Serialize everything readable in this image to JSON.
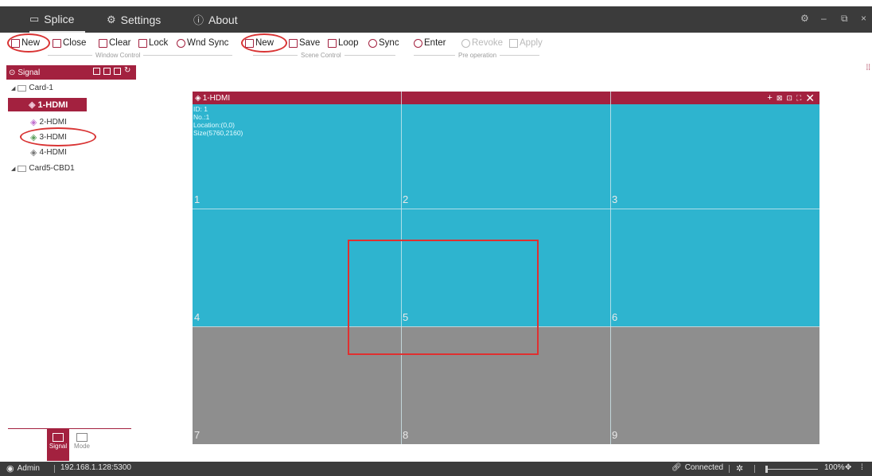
{
  "titlebar": {
    "tabs": [
      {
        "label": "Splice",
        "icon": "window-icon"
      },
      {
        "label": "Settings",
        "icon": "gear-icon"
      },
      {
        "label": "About",
        "icon": "info-icon"
      }
    ],
    "controls": {
      "settings": "⚙",
      "minimize": "–",
      "restore": "⧉",
      "close": "×"
    }
  },
  "toolbar": {
    "window_control": {
      "label": "Window Control",
      "buttons": [
        "New",
        "Close",
        "Clear",
        "Lock",
        "Wnd Sync"
      ]
    },
    "scene_control": {
      "label": "Scene Control",
      "buttons": [
        "New",
        "Save",
        "Loop",
        "Sync"
      ]
    },
    "pre_operation": {
      "label": "Pre operation",
      "buttons": [
        "Enter",
        "Revoke",
        "Apply"
      ]
    }
  },
  "left_panel": {
    "header": "Signal",
    "tree": {
      "card1": "Card-1",
      "signals": [
        "1-HDMI",
        "2-HDMI",
        "3-HDMI",
        "4-HDMI"
      ],
      "card2": "Card5-CBD1"
    },
    "bottom_tabs": [
      "Signal",
      "Mode"
    ]
  },
  "signal_window": {
    "title": "1-HDMI",
    "info": [
      "ID: 1",
      "No.:1",
      "Location:(0,0)",
      "Size(5760,2160)"
    ]
  },
  "grid_cells": [
    "1",
    "2",
    "3",
    "4",
    "5",
    "6",
    "7",
    "8",
    "9"
  ],
  "statusbar": {
    "user": "Admin",
    "address": "192.168.1.128:5300",
    "connection": "Connected",
    "zoom": "100%"
  },
  "colors": {
    "accent": "#a3213f",
    "window_fill": "#2eb4cf",
    "wall_fill": "#8e8e8e",
    "chrome": "#3b3b3b",
    "annotation": "#d93434"
  }
}
